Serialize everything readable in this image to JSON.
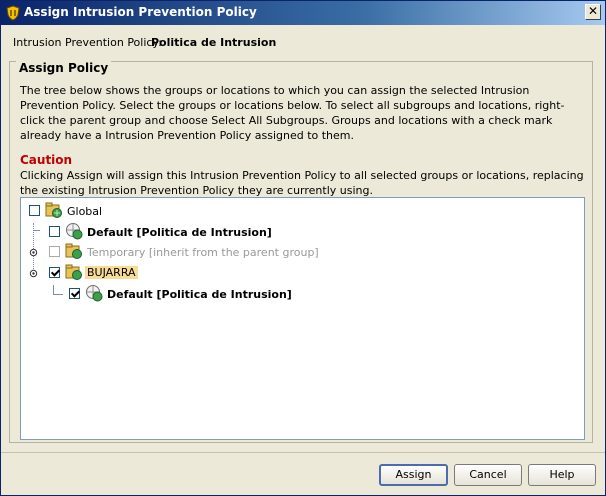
{
  "window": {
    "title": "Assign Intrusion Prevention Policy"
  },
  "policy": {
    "label": "Intrusion Prevention Policy:",
    "value": "Politica de Intrusion"
  },
  "assign_policy": {
    "legend": "Assign Policy",
    "description": "The tree below shows the groups or locations to which you can assign the selected Intrusion Prevention Policy. Select the groups or locations below. To select all subgroups and locations, right-click the parent group and choose Select All Subgroups. Groups and locations with a check mark already have a Intrusion Prevention Policy assigned to them.",
    "caution_title": "Caution",
    "caution_text": "Clicking Assign will assign this Intrusion Prevention Policy to all selected groups or locations, replacing the existing Intrusion Prevention Policy they are currently using."
  },
  "tree": {
    "nodes": [
      {
        "label": "Global",
        "checked": false,
        "style": "normal",
        "icon": "group-icon"
      },
      {
        "label": "Default [Politica de Intrusion]",
        "checked": false,
        "style": "bold",
        "icon": "location-icon"
      },
      {
        "label": "Temporary [inherit from the parent group]",
        "checked": false,
        "style": "grey",
        "icon": "group-icon"
      },
      {
        "label": "BUJARRA",
        "checked": true,
        "style": "highlight",
        "icon": "group-icon"
      },
      {
        "label": "Default [Politica de Intrusion]",
        "checked": true,
        "style": "bold",
        "icon": "location-icon"
      }
    ]
  },
  "buttons": {
    "assign": "Assign",
    "cancel": "Cancel",
    "help": "Help"
  },
  "colors": {
    "caution": "#c00000",
    "selection": "#f7dc96",
    "titlebar": "#0a246a"
  }
}
